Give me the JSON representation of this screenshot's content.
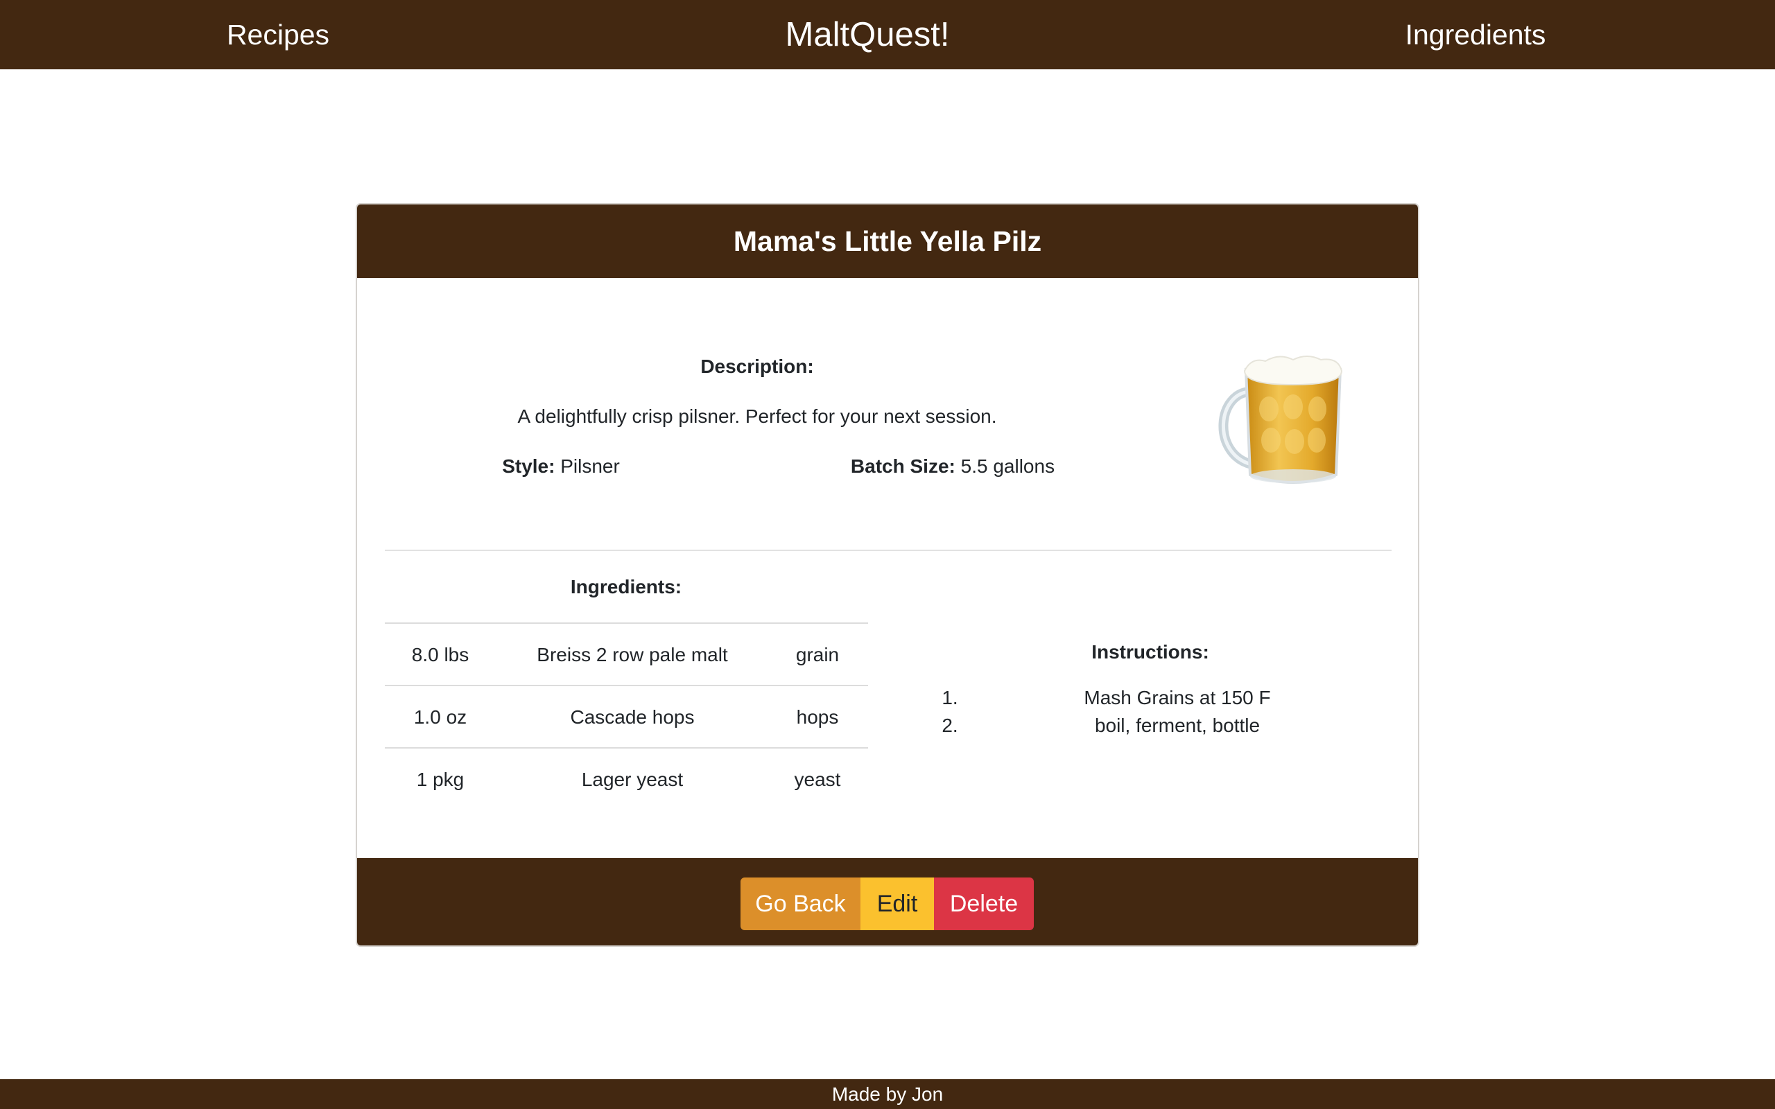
{
  "nav": {
    "recipes_label": "Recipes",
    "brand": "MaltQuest!",
    "ingredients_label": "Ingredients"
  },
  "recipe": {
    "title": "Mama's Little Yella Pilz",
    "description_label": "Description:",
    "description": "A delightfully crisp pilsner. Perfect for your next session.",
    "style_label": "Style:",
    "style": "Pilsner",
    "batch_size_label": "Batch Size:",
    "batch_size": "5.5 gallons",
    "ingredients_heading": "Ingredients:",
    "ingredients": [
      {
        "amount": "8.0 lbs",
        "name": "Breiss 2 row pale malt",
        "type": "grain"
      },
      {
        "amount": "1.0 oz",
        "name": "Cascade hops",
        "type": "hops"
      },
      {
        "amount": "1 pkg",
        "name": "Lager yeast",
        "type": "yeast"
      }
    ],
    "instructions_heading": "Instructions:",
    "instructions": [
      {
        "num": "1.",
        "text": "Mash Grains at 150 F"
      },
      {
        "num": "2.",
        "text": "boil, ferment, bottle"
      }
    ]
  },
  "actions": {
    "go_back_label": "Go Back",
    "edit_label": "Edit",
    "delete_label": "Delete"
  },
  "footer": {
    "credit": "Made by Jon"
  },
  "colors": {
    "brand_brown": "#432811",
    "go_back": "#dc8f2a",
    "edit": "#fbc12e",
    "delete": "#dc3545"
  },
  "icons": {
    "recipe_image": "beer-mug-icon"
  }
}
